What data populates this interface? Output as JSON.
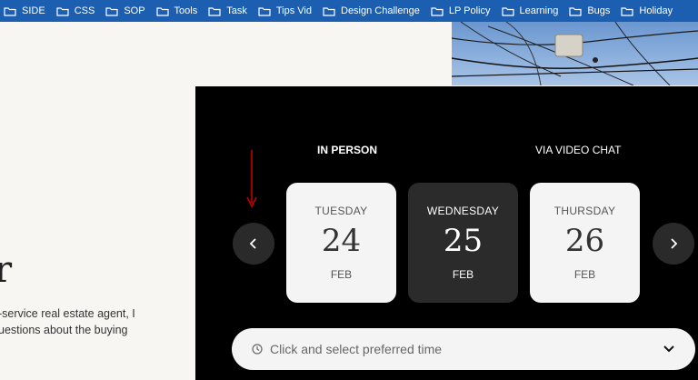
{
  "bookmarks": [
    {
      "label": "SIDE"
    },
    {
      "label": "CSS"
    },
    {
      "label": "SOP"
    },
    {
      "label": "Tools"
    },
    {
      "label": "Task"
    },
    {
      "label": "Tips Vid"
    },
    {
      "label": "Design Challenge"
    },
    {
      "label": "LP Policy"
    },
    {
      "label": "Learning"
    },
    {
      "label": "Bugs"
    },
    {
      "label": "Holiday"
    }
  ],
  "hero": {
    "big_letter": "r",
    "intro_line1": "-service real estate agent, I",
    "intro_line2": "uestions about the buying"
  },
  "booking": {
    "tab_in_person": "IN PERSON",
    "tab_video": "VIA VIDEO CHAT",
    "active_tab": "IN PERSON",
    "days": [
      {
        "dow": "TUESDAY",
        "num": "24",
        "mon": "FEB",
        "selected": false
      },
      {
        "dow": "WEDNESDAY",
        "num": "25",
        "mon": "FEB",
        "selected": true
      },
      {
        "dow": "THURSDAY",
        "num": "26",
        "mon": "FEB",
        "selected": false
      }
    ],
    "time_placeholder": "Click and select preferred time"
  },
  "colors": {
    "bookmark_bar": "#1c5fb0",
    "panel": "#000000",
    "card_light": "#f4f4f4",
    "card_selected": "#2b2b2b",
    "annotation_arrow": "#c00000"
  },
  "icons": {
    "bookmark": "folder-icon",
    "prev": "chevron-left-icon",
    "next": "chevron-right-icon",
    "time": "clock-icon",
    "dropdown": "chevron-down-icon"
  }
}
